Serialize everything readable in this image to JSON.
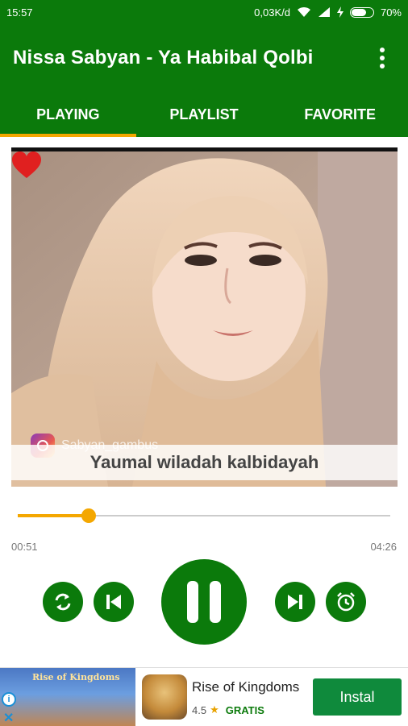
{
  "status_bar": {
    "time": "15:57",
    "net_speed": "0,03K/d",
    "battery": "70%",
    "icons": [
      "wifi-icon",
      "signal-icon",
      "charging-icon",
      "battery-icon"
    ]
  },
  "app_bar": {
    "title": "Nissa Sabyan - Ya Habibal Qolbi",
    "menu_icon": "more-vert-icon"
  },
  "tabs": [
    {
      "label": "PLAYING",
      "active": true
    },
    {
      "label": "PLAYLIST",
      "active": false
    },
    {
      "label": "FAVORITE",
      "active": false
    }
  ],
  "cover": {
    "favorite_icon": "heart-icon",
    "watermark": "Sabyan_gambus",
    "lyric": "Yaumal wiladah kalbidayah"
  },
  "player": {
    "current_time": "00:51",
    "total_time": "04:26",
    "progress": 0.19,
    "controls": [
      "repeat-icon",
      "previous-icon",
      "pause-icon",
      "next-icon",
      "alarm-icon"
    ]
  },
  "ad": {
    "banner_text": "Rise of Kingdoms",
    "title": "Rise of Kingdoms",
    "rating": "4.5",
    "price": "GRATIS",
    "install_label": "Instal",
    "info_icon": "info-icon",
    "close_icon": "close-icon"
  },
  "colors": {
    "primary": "#0b7a0b",
    "accent": "#f4a700",
    "heart": "#e02020",
    "install": "#0f8a3c"
  }
}
